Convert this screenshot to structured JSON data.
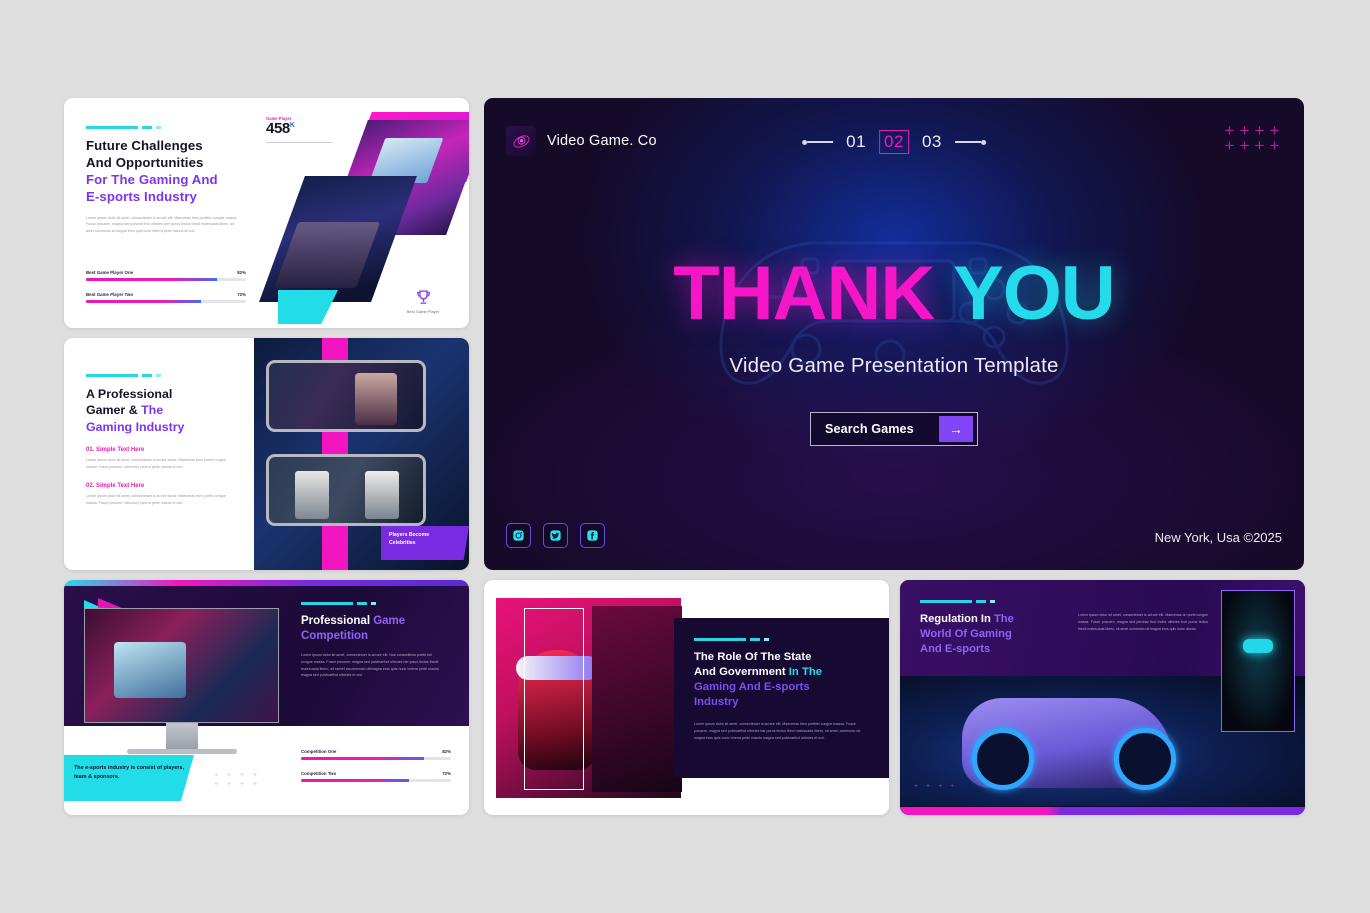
{
  "page": {
    "background": "#dedede"
  },
  "main_slide": {
    "logo": {
      "icon": "planet-orbit-icon",
      "text": "Video Game. Co"
    },
    "pager": {
      "prev_icon": "arrow-left-icon",
      "next_icon": "arrow-right-icon",
      "items": [
        "01",
        "02",
        "03"
      ],
      "active": "02"
    },
    "decor": {
      "plus_grid_icon": "plus-grid-icon",
      "count": 8,
      "gamepad_watermark_icon": "gamepad-icon"
    },
    "title": {
      "part1": "THANK",
      "part2": "YOU",
      "color1": "#f516c8",
      "color2": "#24dbec"
    },
    "subtitle": "Video Game Presentation Template",
    "cta": {
      "label": "Search Games",
      "icon": "arrow-right-icon",
      "accent": "#8145f5"
    },
    "socials": [
      {
        "name": "instagram-icon",
        "label": "Instagram"
      },
      {
        "name": "twitter-icon",
        "label": "Twitter"
      },
      {
        "name": "facebook-icon",
        "label": "Facebook"
      }
    ],
    "copyright": "New York, Usa ©2025"
  },
  "thumb1": {
    "heading": {
      "line1": "Future Challenges",
      "line2": "And Opportunities",
      "line3": "For The Gaming And",
      "line4": "E-sports Industry"
    },
    "body": "Lorem ipsum dolor sit amet, consectetuer is ad are elit. Maecenas thes porttitor congue massa. Fusce posuere, magna sed pulvinar thol ultricies lper purus lectus theoll malesuada libero, sit amet commodo at magna eros quis luctu viverra pede mauris at orci.",
    "stat": {
      "label": "Game Player",
      "value": "458",
      "unit": "K"
    },
    "trophy": {
      "icon": "trophy-icon",
      "label": "Best Game Player"
    },
    "bars": [
      {
        "label": "Best Game Player One",
        "value": "82%",
        "pct": 82
      },
      {
        "label": "Best Game Player Two",
        "value": "72%",
        "pct": 72
      }
    ]
  },
  "thumb2": {
    "heading": {
      "line1": "A Professional",
      "line2a": "Gamer & ",
      "line2b": "The",
      "line3": "Gaming Industry"
    },
    "sections": [
      {
        "title": "01. Simple Text Here",
        "body": "Lorem ipsum dolor sit amet, consectetuer is ad are sodor. Maecenas theo porttit congue massa. Fusce posuere, ultricium) viverra pede mauris et orci"
      },
      {
        "title": "02. Simple Text Here",
        "body": "Lorem ipsum dolor sit amet, consectetuer is ad are sodor. Maecenas theo porttit congue massa. Fusce posuere, ultricium) viverra pede mauris et orci"
      }
    ],
    "tag": {
      "line1": "Players Become",
      "line2": "Celebrities"
    }
  },
  "thumb3": {
    "heading": {
      "part1": "Professional ",
      "part2": "Game",
      "line2": "Competition"
    },
    "body": "Lorem ipsum dolor sit amet, consectetuer is ad are elit. Nue consedithes porttit hel congue massa. Fusce posuere, magna sed pulvinarthol ultricies ber ipsuo lectus theoll malesuada libero, sit samet accommodo ultimagna eros quis nunc viverra pede mauris magna sed pulvinarthol ultricies et orci.",
    "callout": "The e-sports industry is consist of players, team & sponsors.",
    "bars": [
      {
        "label": "Competition One",
        "value": "82%",
        "pct": 82
      },
      {
        "label": "Competition Two",
        "value": "72%",
        "pct": 72
      }
    ]
  },
  "thumb4": {
    "heading": {
      "line1": "The Role Of The State",
      "line2a": "And Government ",
      "line2b": "In The",
      "line3": "Gaming And E-sports",
      "line4": "Industry"
    },
    "body": "Lorem ipsum dolor sit amet, consectetuer is ad are elit. Maecenas theo porttitel congue massa. Fusce posuere, magna sed pulvinarthol ultricies bar purus lectus theol malesuada libero, sit amet, commodo ult magna eros quis nunc viverra pede mauris magna sed pulvinarthol ultricies et orci."
  },
  "thumb5": {
    "heading": {
      "part1": "Regulation In ",
      "part2": "The",
      "line2": "World Of Gaming",
      "line3": "And E-sports"
    },
    "body": "Lorem ipsum dolor sit amet, consectetuer is ad are elit. Maecenas on portti congue massa. Fusce posuere, magna sed pulvinar thol rhobs ultricies bon purus lectus theoll malesuada libero, sit amet commodo ult magna eros quis nunc utorcis."
  }
}
